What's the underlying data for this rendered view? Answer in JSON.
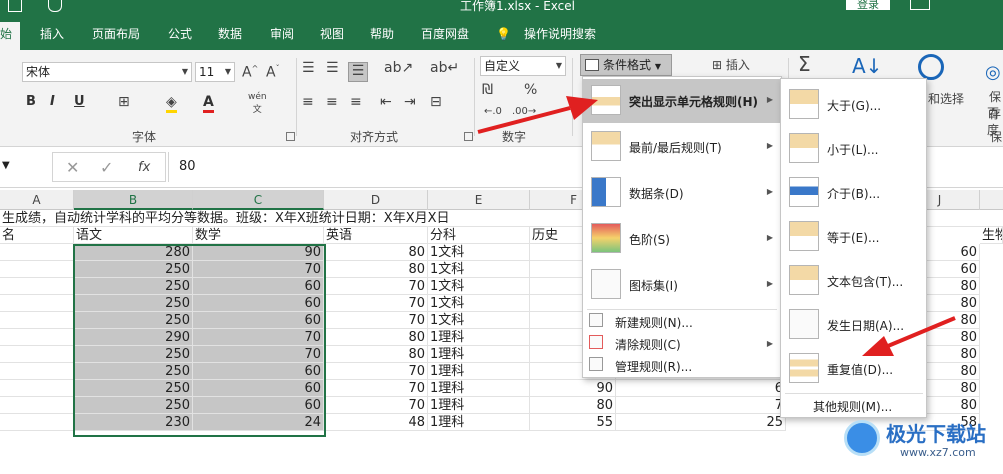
{
  "title": "工作簿1.xlsx - Excel",
  "login": "登录",
  "tabs": {
    "home": "始",
    "insert": "插入",
    "page_layout": "页面布局",
    "formulas": "公式",
    "data": "数据",
    "review": "审阅",
    "view": "视图",
    "help": "帮助",
    "baidu": "百度网盘",
    "search": "操作说明搜索"
  },
  "ribbon": {
    "font_name": "宋体",
    "font_size": "11",
    "font_group": "字体",
    "align_group": "对齐方式",
    "number_group": "数字",
    "number_format": "自定义",
    "cond_format": "条件格式",
    "insert": "插入",
    "find_select": "和选择",
    "save_label1": "保存",
    "save_label2": "百度",
    "save_label3": "保",
    "bold": "B",
    "italic": "I",
    "underline": "U",
    "sigma": "Σ",
    "percent": "%"
  },
  "formula_bar": {
    "fx": "fx",
    "value": "80"
  },
  "columns": [
    "A",
    "B",
    "C",
    "D",
    "E",
    "F",
    "J"
  ],
  "sheet": {
    "row1": "生成绩，自动统计学科的平均分等数据。班级：X年X班统计日期：X年X月X日",
    "headers": {
      "name": "名",
      "chinese": "语文",
      "math": "数学",
      "english": "英语",
      "subject": "分科",
      "history": "历史",
      "bio": "生物"
    },
    "rows": [
      {
        "b": "280",
        "c": "90",
        "d": "80",
        "e": "1文科",
        "f": "",
        "g": "",
        "j": "60"
      },
      {
        "b": "250",
        "c": "70",
        "d": "80",
        "e": "1文科",
        "f": "",
        "g": "",
        "j": "60"
      },
      {
        "b": "250",
        "c": "60",
        "d": "70",
        "e": "1文科",
        "f": "",
        "g": "",
        "j": "80"
      },
      {
        "b": "250",
        "c": "60",
        "d": "70",
        "e": "1文科",
        "f": "",
        "g": "",
        "j": "80"
      },
      {
        "b": "250",
        "c": "60",
        "d": "70",
        "e": "1文科",
        "f": "",
        "g": "",
        "j": "80"
      },
      {
        "b": "290",
        "c": "70",
        "d": "80",
        "e": "1理科",
        "f": "",
        "g": "",
        "j": "80"
      },
      {
        "b": "250",
        "c": "70",
        "d": "80",
        "e": "1理科",
        "f": "",
        "g": "",
        "j": "80"
      },
      {
        "b": "250",
        "c": "60",
        "d": "70",
        "e": "1理科",
        "f": "",
        "g": "",
        "j": "80"
      },
      {
        "b": "250",
        "c": "60",
        "d": "70",
        "e": "1理科",
        "f": "90",
        "g": "6",
        "j": "80"
      },
      {
        "b": "250",
        "c": "60",
        "d": "70",
        "e": "1理科",
        "f": "80",
        "g": "7",
        "j": "80"
      },
      {
        "b": "230",
        "c": "24",
        "d": "48",
        "e": "1理科",
        "f": "55",
        "g": "25",
        "j": "58"
      }
    ]
  },
  "cf_menu": {
    "highlight_rules": "突出显示单元格规则(H)",
    "top_bottom": "最前/最后规则(T)",
    "data_bars": "数据条(D)",
    "color_scales": "色阶(S)",
    "icon_sets": "图标集(I)",
    "new_rule": "新建规则(N)...",
    "clear_rules": "清除规则(C)",
    "manage_rules": "管理规则(R)..."
  },
  "sub_menu": {
    "greater": "大于(G)...",
    "less": "小于(L)...",
    "between": "介于(B)...",
    "equal": "等于(E)...",
    "text_contains": "文本包含(T)...",
    "date_occurring": "发生日期(A)...",
    "duplicate": "重复值(D)...",
    "more_rules": "其他规则(M)..."
  },
  "watermark": {
    "name": "极光下载站",
    "url": "www.xz7.com"
  },
  "colors": {
    "brand": "#217346",
    "selection": "#c6c6c6",
    "arrow": "#e02020"
  }
}
